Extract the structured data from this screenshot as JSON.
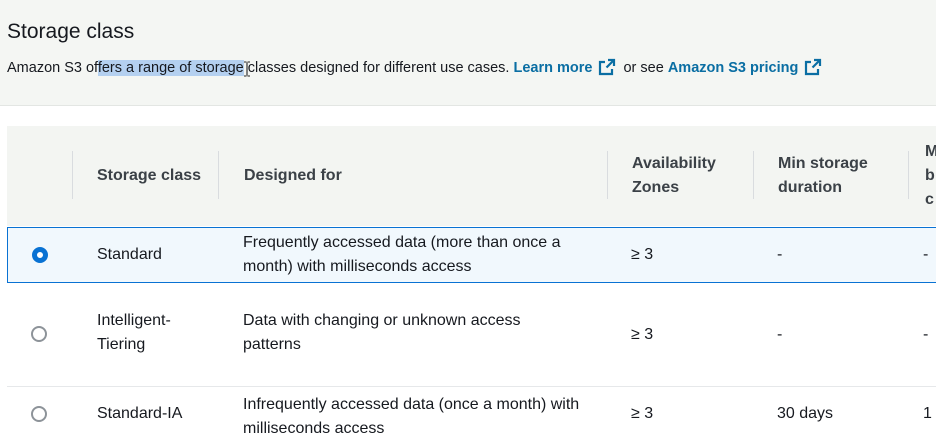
{
  "section": {
    "title": "Storage class",
    "description_part1": "Amazon S3 of",
    "description_highlight": "fers a range of storage",
    "description_part2": " classes designed for different use cases. ",
    "learn_more": "Learn more",
    "or_see": " or see ",
    "pricing_link": "Amazon S3 pricing"
  },
  "table": {
    "headers": {
      "storage_class": "Storage class",
      "designed_for": "Designed for",
      "availability_zones": "Availability Zones",
      "min_storage_duration": "Min storage duration",
      "next_col_l1": "M",
      "next_col_l2": "b",
      "next_col_l3": "c"
    },
    "rows": [
      {
        "selected": true,
        "storage_class": "Standard",
        "designed_for": "Frequently accessed data (more than once a month) with milliseconds access",
        "availability_zones": "≥ 3",
        "min_storage_duration": "-",
        "next_col": "-"
      },
      {
        "selected": false,
        "storage_class": "Intelligent-Tiering",
        "designed_for": "Data with changing or unknown access patterns",
        "availability_zones": "≥ 3",
        "min_storage_duration": "-",
        "next_col": "-"
      },
      {
        "selected": false,
        "storage_class": "Standard-IA",
        "designed_for": "Infrequently accessed data (once a month) with milliseconds access",
        "availability_zones": "≥ 3",
        "min_storage_duration": "30 days",
        "next_col": "1"
      }
    ]
  },
  "icons": {
    "external_link": "external-link-icon",
    "text_cursor": "text-cursor-icon"
  },
  "colors": {
    "link": "#0a6ea3",
    "selected_border": "#0972d3",
    "selected_bg": "#f1f8fd",
    "header_bg": "#f3f5f2",
    "text_highlight": "#b4d0f0"
  }
}
